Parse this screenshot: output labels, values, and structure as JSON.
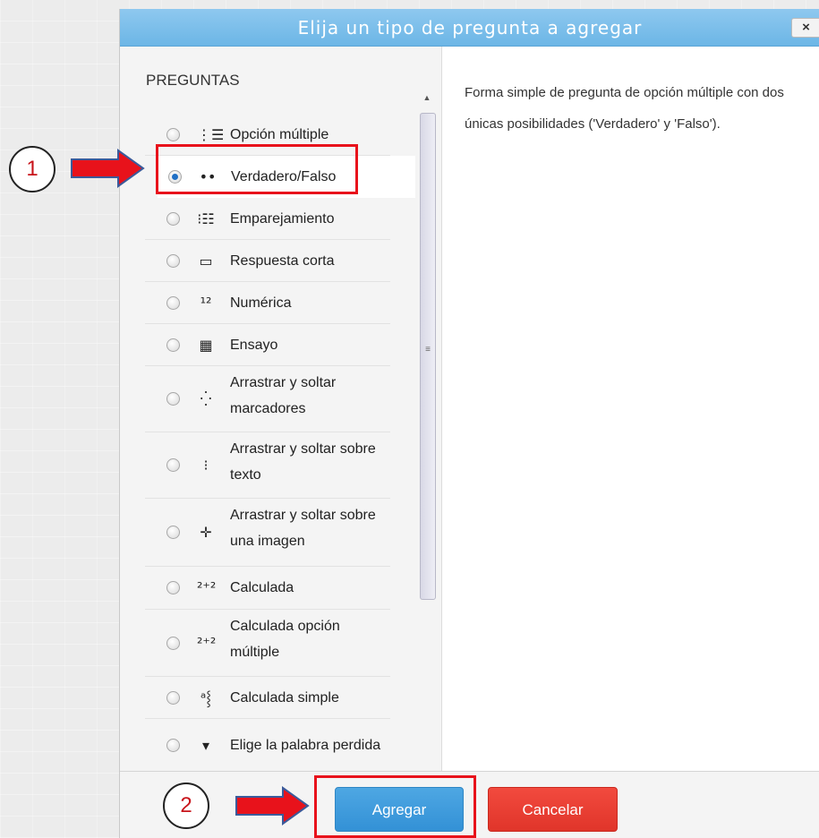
{
  "dialog": {
    "title": "Elija un tipo de pregunta a agregar",
    "close_label": "×",
    "section_heading": "PREGUNTAS",
    "description": "Forma simple de pregunta de opción múltiple con dos únicas posibilidades ('Verdadero' y 'Falso').",
    "items": [
      {
        "label": "Opción múltiple",
        "icon": "multichoice-icon",
        "glyph": "⋮☰",
        "selected": false
      },
      {
        "label": "Verdadero/Falso",
        "icon": "truefalse-icon",
        "glyph": "••",
        "selected": true
      },
      {
        "label": "Emparejamiento",
        "icon": "match-icon",
        "glyph": "⁝☷",
        "selected": false
      },
      {
        "label": "Respuesta corta",
        "icon": "shortanswer-icon",
        "glyph": "▭",
        "selected": false
      },
      {
        "label": "Numérica",
        "icon": "numerical-icon",
        "glyph": "¹²",
        "selected": false
      },
      {
        "label": "Ensayo",
        "icon": "essay-icon",
        "glyph": "▦",
        "selected": false
      },
      {
        "label": "Arrastrar y soltar marcadores",
        "icon": "ddmarker-icon",
        "glyph": "⁛",
        "selected": false
      },
      {
        "label": "Arrastrar y soltar sobre texto",
        "icon": "ddwtos-icon",
        "glyph": "⁝",
        "selected": false
      },
      {
        "label": "Arrastrar y soltar sobre una imagen",
        "icon": "ddimage-icon",
        "glyph": "✛",
        "selected": false
      },
      {
        "label": "Calculada",
        "icon": "calculated-icon",
        "glyph": "²⁺²",
        "selected": false
      },
      {
        "label": "Calculada opción múltiple",
        "icon": "calculatedmulti-icon",
        "glyph": "²⁺²",
        "selected": false
      },
      {
        "label": "Calculada simple",
        "icon": "calculatedsimple-icon",
        "glyph": "ᵃ⸾",
        "selected": false
      },
      {
        "label": "Elige la palabra perdida",
        "icon": "gapselect-icon",
        "glyph": "▾",
        "selected": false
      }
    ],
    "add_button": "Agregar",
    "cancel_button": "Cancelar"
  },
  "annotations": {
    "step1": "1",
    "step2": "2"
  },
  "colors": {
    "title_bar": "#7bbfea",
    "add_button": "#3a98dc",
    "cancel_button": "#e8392e",
    "highlight": "#e8121b"
  }
}
